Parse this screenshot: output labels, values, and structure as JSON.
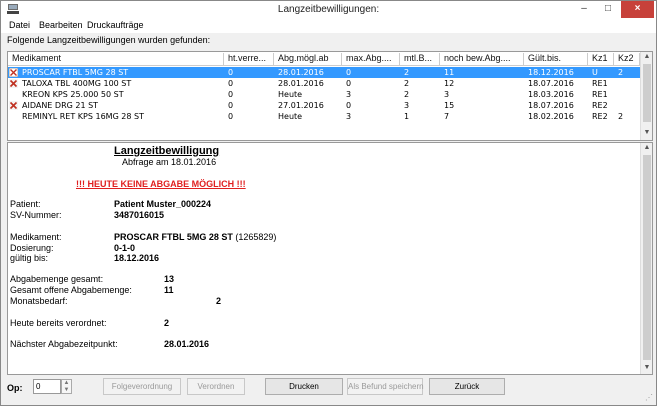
{
  "window": {
    "title": "Langzeitbewilligungen:",
    "minimize": "–",
    "maximize": "□",
    "close": "×"
  },
  "menu": [
    "Datei",
    "Bearbeiten",
    "Druckaufträge"
  ],
  "found_label": "Folgende Langzeitbewilligungen wurden gefunden:",
  "table": {
    "columns": [
      "Medikament",
      "ht.verre...",
      "Abg.mögl.ab",
      "max.Abg....",
      "mtl.B...",
      "noch bew.Abg....",
      "Gült.bis.",
      "Kz1",
      "Kz2"
    ],
    "rows": [
      {
        "icon": "warning-icon",
        "cells": [
          "PROSCAR FTBL 5MG 28 ST",
          "0",
          "28.01.2016",
          "0",
          "2",
          "11",
          "18.12.2016",
          "U",
          "2"
        ]
      },
      {
        "icon": "blocked-icon",
        "cells": [
          "TALOXA TBL 400MG 100 ST",
          "0",
          "28.01.2016",
          "0",
          "2",
          "12",
          "18.07.2016",
          "RE1",
          ""
        ]
      },
      {
        "icon": "",
        "cells": [
          "KREON KPS 25.000 50 ST",
          "0",
          "Heute",
          "3",
          "2",
          "3",
          "18.03.2016",
          "RE1",
          ""
        ]
      },
      {
        "icon": "blocked-icon",
        "cells": [
          "AIDANE DRG 21 ST",
          "0",
          "27.01.2016",
          "0",
          "3",
          "15",
          "18.07.2016",
          "RE2",
          ""
        ]
      },
      {
        "icon": "",
        "cells": [
          "REMINYL RET KPS 16MG 28 ST",
          "0",
          "Heute",
          "3",
          "1",
          "7",
          "18.02.2016",
          "RE2",
          "2"
        ]
      }
    ]
  },
  "details": {
    "title": "Langzeitbewilligung",
    "subtitle": "Abfrage am 18.01.2016",
    "warning": "!!! HEUTE KEINE ABGABE MÖGLICH !!!",
    "patient_label": "Patient:",
    "patient_value": "Patient Muster_000224",
    "sv_label": "SV-Nummer:",
    "sv_value": "3487016015",
    "med_label": "Medikament:",
    "med_value": "PROSCAR FTBL 5MG 28 ST",
    "med_code": "(1265829)",
    "dose_label": "Dosierung:",
    "dose_value": "0-1-0",
    "valid_label": "gültig bis:",
    "valid_value": "18.12.2016",
    "total_label": "Abgabemenge gesamt:",
    "total_value": "13",
    "open_label": "Gesamt offene Abgabemenge:",
    "open_value": "11",
    "monthly_label": "Monatsbedarf:",
    "monthly_value": "2",
    "today_label": "Heute bereits verordnet:",
    "today_value": "2",
    "next_label": "Nächster Abgabezeitpunkt:",
    "next_value": "28.01.2016"
  },
  "bottom": {
    "op_label": "Op:",
    "op_value": "0",
    "buttons": [
      {
        "label": "Folgeverordnung",
        "enabled": false
      },
      {
        "label": "Verordnen",
        "enabled": false
      },
      {
        "label": "Drucken",
        "enabled": true
      },
      {
        "label": "Als Befund speichern",
        "enabled": false
      },
      {
        "label": "Zurück",
        "enabled": true
      }
    ]
  },
  "colors": {
    "selection": "#3399ff",
    "warning": "#e02020",
    "close_button": "#c7413a"
  }
}
